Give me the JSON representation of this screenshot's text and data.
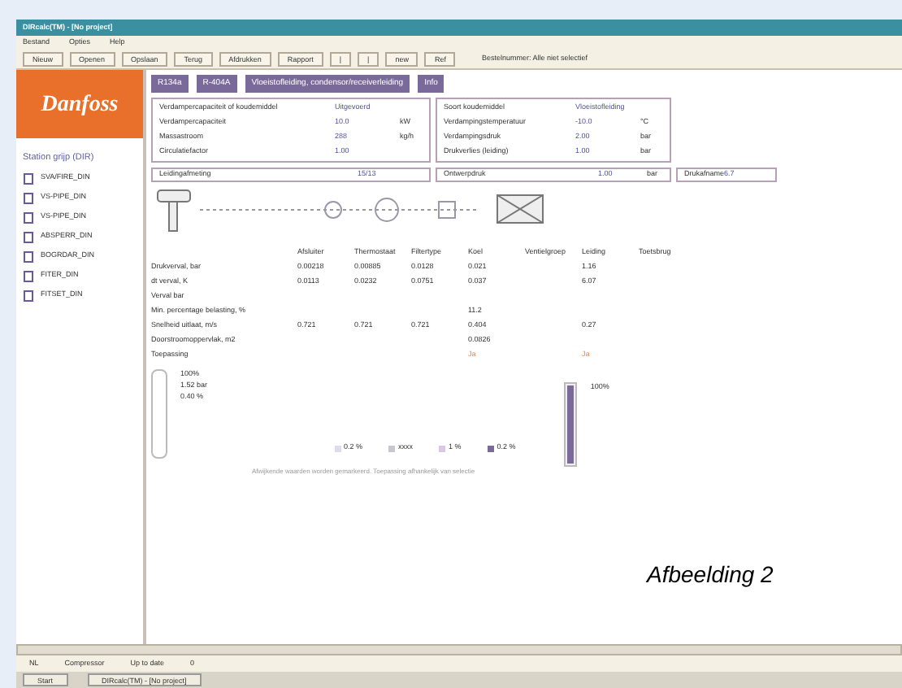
{
  "window": {
    "title": "DIRcalc(TM) - [No project]"
  },
  "menu": [
    "Bestand",
    "Opties",
    "Help"
  ],
  "toolbar": {
    "buttons": [
      "Nieuw",
      "Openen",
      "Opslaan",
      "Terug",
      "Afdrukken",
      "Rapport",
      "|",
      "|",
      "new",
      "Ref"
    ],
    "info": "Bestelnummer: Alle niet selectief"
  },
  "logo": {
    "text": "Danfoss"
  },
  "sidebar": {
    "title": "Station grijp (DIR)",
    "items": [
      {
        "label": "SVA/FIRE_DIN"
      },
      {
        "label": "VS-PIPE_DIN"
      },
      {
        "label": "VS-PIPE_DIN"
      },
      {
        "label": "ABSPERR_DIN"
      },
      {
        "label": "BOGRDAR_DIN"
      },
      {
        "label": "FITER_DIN"
      },
      {
        "label": "FITSET_DIN"
      }
    ]
  },
  "mode_buttons": [
    "R134a",
    "R-404A",
    "Vloeistofleiding, condensor/receiverleiding",
    "Info"
  ],
  "inputs_left": [
    {
      "label": "Verdampercapaciteit of koudemiddel",
      "value": "Uitgevoerd"
    },
    {
      "label": "Verdampercapaciteit",
      "value": "10.0",
      "unit": "kW"
    },
    {
      "label": "Massastroom",
      "value": "288",
      "unit": "kg/h"
    },
    {
      "label": "Circulatiefactor",
      "value": "1.00"
    }
  ],
  "inputs_right": [
    {
      "label": "Soort koudemiddel",
      "value": "Vloeistofleiding"
    },
    {
      "label": "Verdampingstemperatuur",
      "value": "-10.0",
      "unit": "°C"
    },
    {
      "label": "Verdampingsdruk",
      "value": "2.00",
      "unit": "bar"
    },
    {
      "label": "Drukverlies (leiding)",
      "value": "1.00",
      "unit": "bar"
    }
  ],
  "fields": [
    {
      "label": "Leidingafmeting",
      "value": "15/13"
    },
    {
      "label": "Ontwerpdruk",
      "value": "1.00",
      "unit": "bar"
    },
    {
      "label": "Drukafname",
      "value": "6.7"
    }
  ],
  "results": {
    "columns": [
      "Afsluiter",
      "Thermostaat",
      "Filtertype",
      "Koel",
      "Ventielgroep",
      "Leiding",
      "Toetsbrug"
    ],
    "rows": [
      {
        "kind": "value",
        "label": "Drukverval, bar",
        "cells": [
          "0.00218",
          "0.00885",
          "0.0128",
          "0.021",
          "",
          "1.16"
        ]
      },
      {
        "kind": "value",
        "label": "dt verval, K",
        "cells": [
          "0.0113",
          "0.0232",
          "0.0751",
          "0.037",
          "",
          "6.07"
        ]
      },
      {
        "kind": "value",
        "label": "Verval bar",
        "cells": [
          "",
          "",
          "",
          "",
          "",
          ""
        ]
      },
      {
        "kind": "value",
        "label": "Min. percentage belasting, %",
        "cells": [
          "",
          "",
          "",
          "11.2",
          "",
          ""
        ]
      },
      {
        "kind": "value",
        "label": "Snelheid uitlaat, m/s",
        "cells": [
          "0.721",
          "0.721",
          "0.721",
          "0.404",
          "",
          "0.27"
        ]
      },
      {
        "kind": "value",
        "label": "Doorstroomoppervlak, m2",
        "cells": [
          "",
          "",
          "",
          "0.0826",
          "",
          ""
        ]
      },
      {
        "kind": "status",
        "label": "Toepassing",
        "cells": [
          "",
          "",
          "",
          "Ja",
          "",
          "Ja"
        ]
      }
    ]
  },
  "summary": {
    "lines": [
      "100%",
      "1.52 bar",
      "0.40 %"
    ]
  },
  "legend": [
    {
      "label": "0.2 %",
      "color": "#e0dce8"
    },
    {
      "label": "xxxx",
      "color": "#c8c4d0"
    },
    {
      "label": "1 %",
      "color": "#d8c8e8"
    },
    {
      "label": "0.2 %",
      "color": "#7a6a9a"
    }
  ],
  "gauge": {
    "level": 1,
    "reading": "100%"
  },
  "footnote": "Afwijkende waarden worden gemarkeerd. Toepassing afhankelijk van selectie",
  "caption": "Afbeelding 2",
  "status_bar": [
    "NL",
    "Compressor",
    "Up to date",
    "0"
  ],
  "taskbar": [
    "Start",
    "DIRcalc(TM) - [No project]"
  ]
}
